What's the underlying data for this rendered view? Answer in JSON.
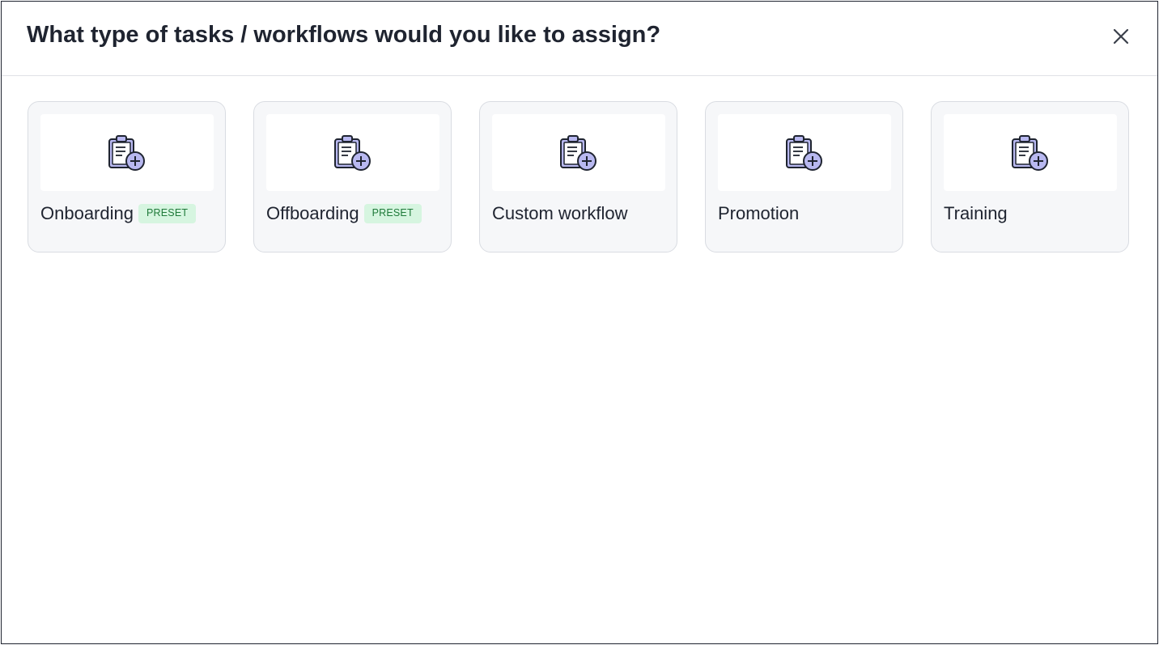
{
  "dialog": {
    "title": "What type of tasks / workflows would you like to assign?",
    "close_icon": "close-icon"
  },
  "cards": [
    {
      "label": "Onboarding",
      "badge": "PRESET",
      "icon": "clipboard-add-icon"
    },
    {
      "label": "Offboarding",
      "badge": "PRESET",
      "icon": "clipboard-add-icon"
    },
    {
      "label": "Custom workflow",
      "badge": "",
      "icon": "clipboard-add-icon"
    },
    {
      "label": "Promotion",
      "badge": "",
      "icon": "clipboard-add-icon"
    },
    {
      "label": "Training",
      "badge": "",
      "icon": "clipboard-add-icon"
    }
  ],
  "colors": {
    "icon_fill": "#b8b8f0",
    "icon_stroke": "#1f2430",
    "badge_bg": "#d6f5e0",
    "badge_text": "#1f7a3a"
  }
}
